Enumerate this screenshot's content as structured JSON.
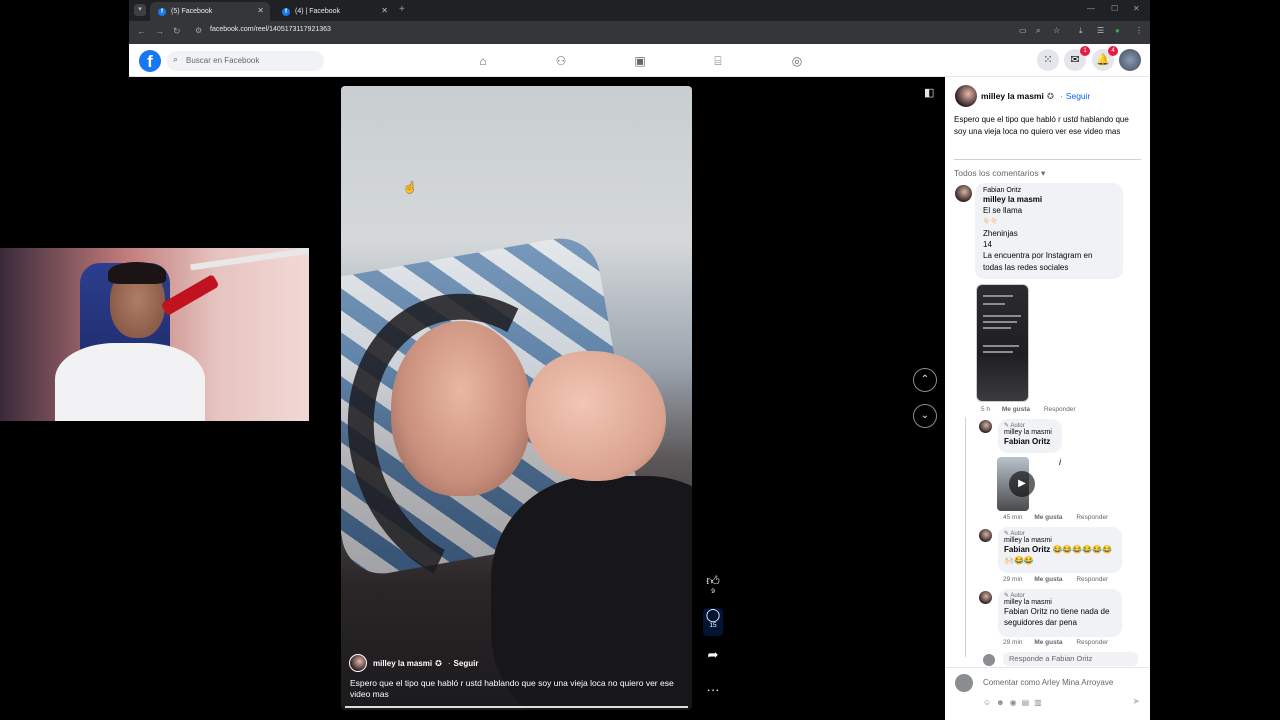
{
  "browser": {
    "tabs": [
      {
        "label": "(5) Facebook",
        "active": true
      },
      {
        "label": "(4) | Facebook",
        "active": false
      }
    ],
    "url": "facebook.com/reel/1405173117921363"
  },
  "header": {
    "logo": "f",
    "search_placeholder": "Buscar en Facebook",
    "nav_icons": [
      "home-icon",
      "friends-icon",
      "video-icon",
      "marketplace-icon",
      "groups-icon"
    ],
    "messenger_badge": "1",
    "notifications_badge": "4"
  },
  "reel": {
    "author": "milley la masmi",
    "follow": "Seguir",
    "separator": "·",
    "caption": "Espero que el tipo que habló r ustd  hablando que soy una vieja loca  no quiero ver ese video mas",
    "likes": "9",
    "comments": "15"
  },
  "panel": {
    "author": "milley la masmi",
    "follow": "Seguir",
    "separator": "·",
    "caption": "Espero que el tipo que habló r ustd  hablando que soy una vieja loca  no quiero ver ese video mas",
    "all_comments": "Todos los comentarios",
    "comments": [
      {
        "author": "Fabian Oritz",
        "lines": [
          "milley la masmi",
          "El se llama",
          "👇🏻👇🏻",
          "Zheninjas",
          "14",
          "La encuentra por Instagram en",
          "todas las redes sociales"
        ],
        "time": "5 h",
        "like": "Me gusta",
        "reply": "Responder"
      },
      {
        "tag": "Autor",
        "author": "milley la masmi",
        "text": "Fabian Oritz",
        "time": "45 min",
        "like": "Me gusta",
        "reply": "Responder"
      },
      {
        "tag": "Autor",
        "author": "milley la masmi",
        "text": "Fabian Oritz 😂😂😂😂😂😂",
        "text2": "🙌🏻😂😂",
        "time": "29 min",
        "like": "Me gusta",
        "reply": "Responder"
      },
      {
        "tag": "Autor",
        "author": "milley la masmi",
        "text": "Fabian Oritz no tiene nada de",
        "text2": "seguidores dar pena",
        "time": "29 min",
        "like": "Me gusta",
        "reply": "Responder"
      }
    ],
    "reply_placeholder": "Responde a Fabian Oritz",
    "compose_placeholder": "Comentar como Arley Mina Arroyave"
  }
}
